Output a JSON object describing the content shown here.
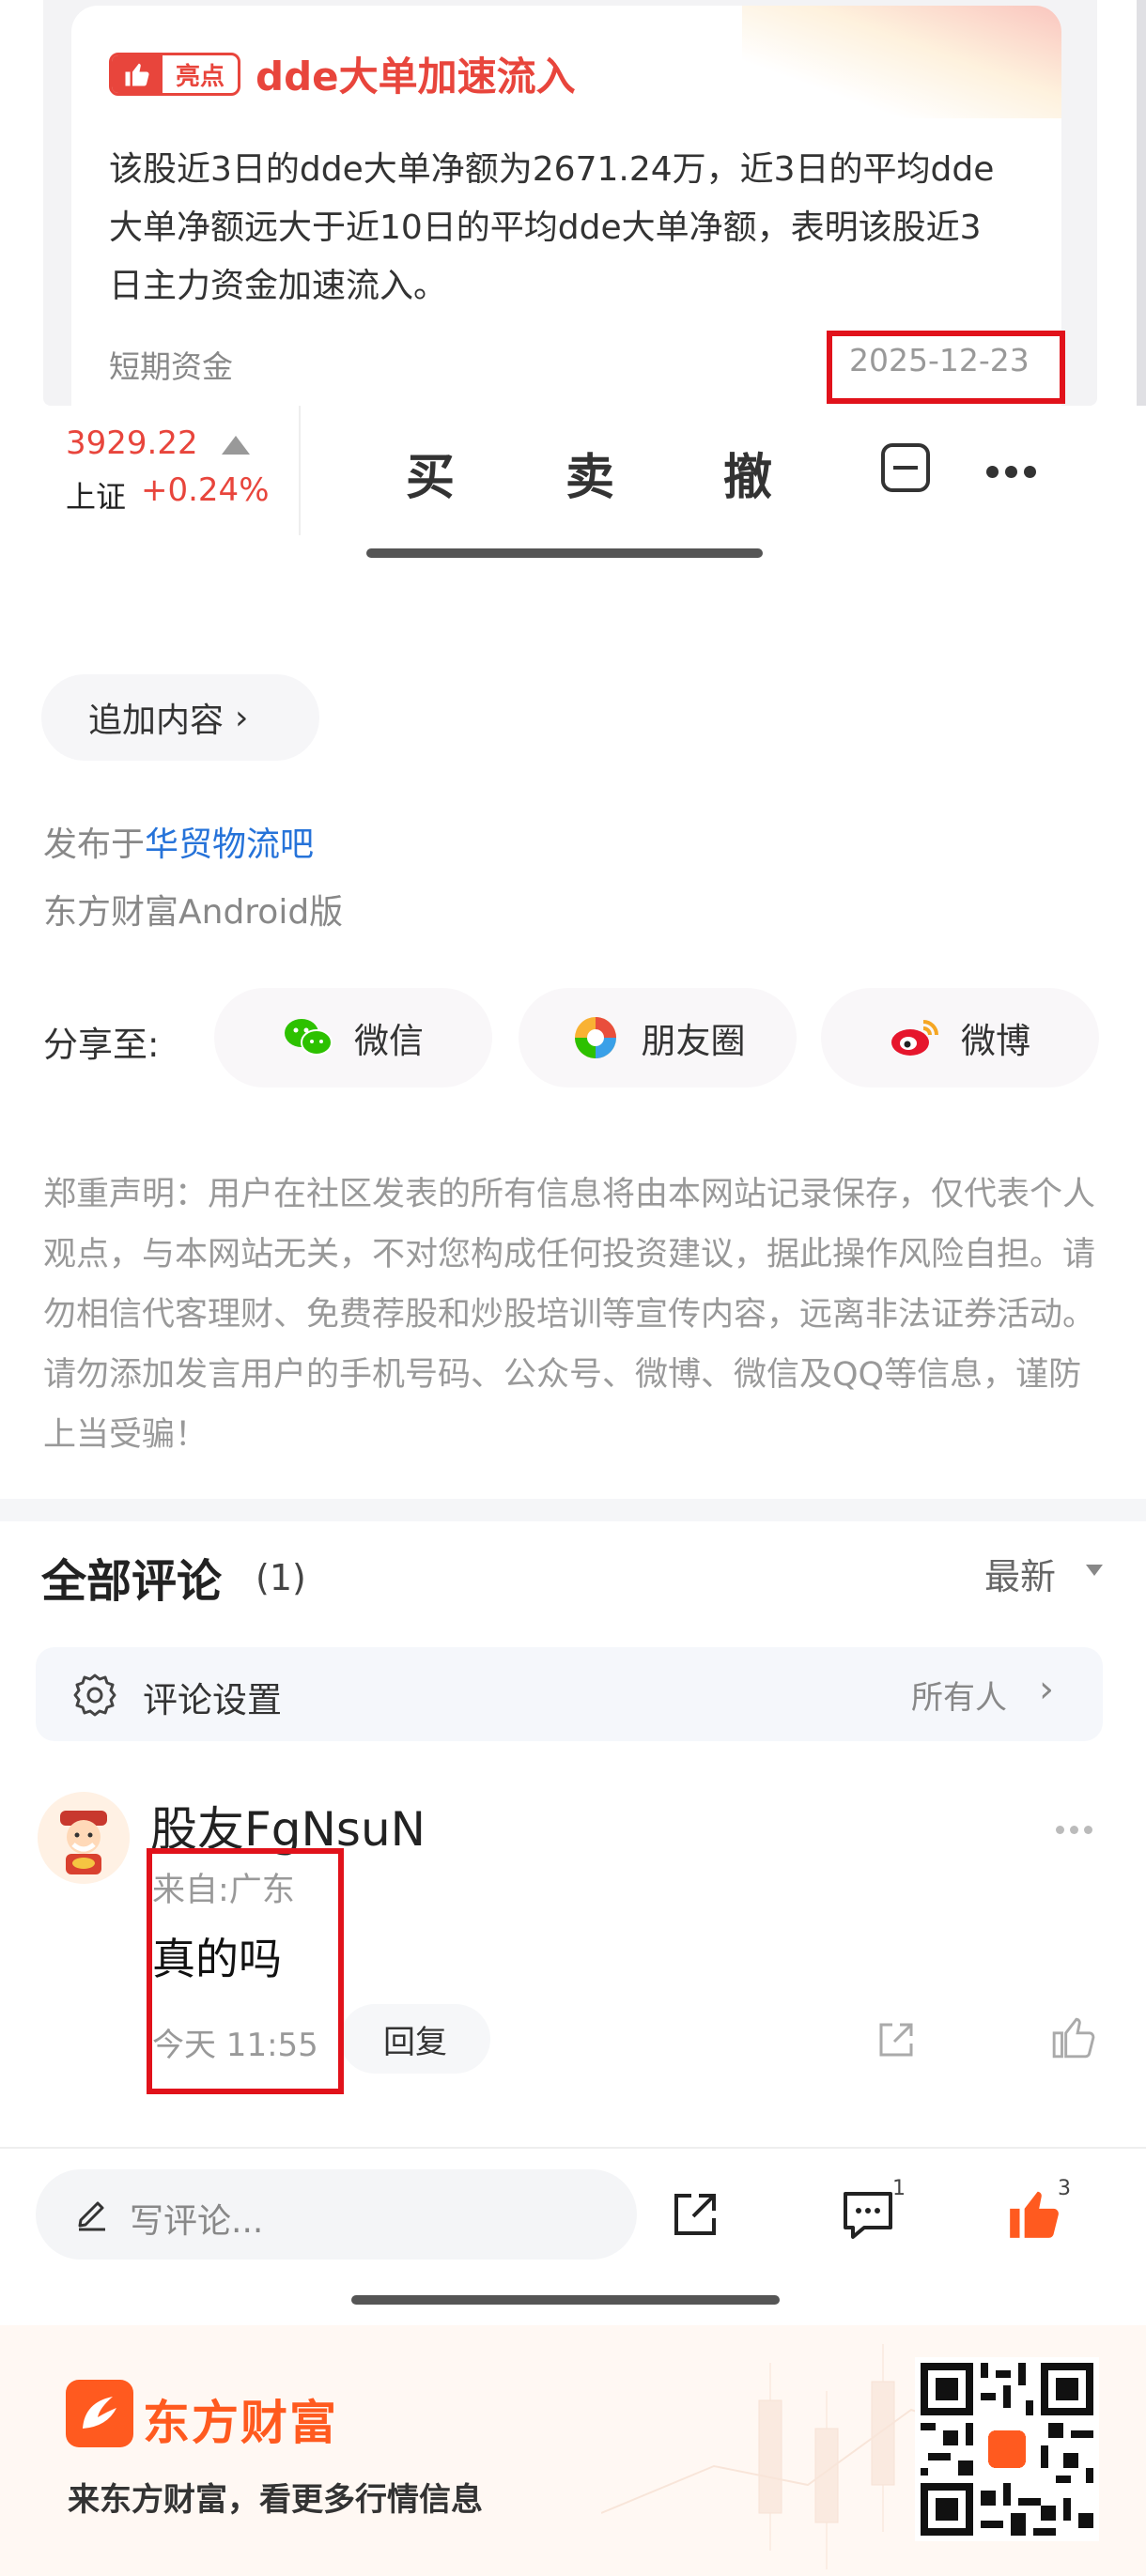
{
  "highlight_card": {
    "badge": "亮点",
    "title": "dde大单加速流入",
    "body": "该股近3日的dde大单净额为2671.24万，近3日的平均dde大单净额远大于近10日的平均dde大单净额，表明该股近3日主力资金加速流入。",
    "tag": "短期资金",
    "date": "2025-12-23"
  },
  "trade_bar": {
    "index_value": "3929.22",
    "index_name": "上证",
    "index_change": "+0.24%",
    "buy": "买",
    "sell": "卖",
    "cancel": "撤",
    "up_color": "#e8453c"
  },
  "post": {
    "append_label": "追加内容",
    "published_prefix": "发布于",
    "forum_name": "华贸物流吧",
    "client": "东方财富Android版"
  },
  "share": {
    "label": "分享至:",
    "wechat": "微信",
    "moments": "朋友圈",
    "weibo": "微博"
  },
  "disclaimer": "郑重声明：用户在社区发表的所有信息将由本网站记录保存，仅代表个人观点，与本网站无关，不对您构成任何投资建议，据此操作风险自担。请勿相信代客理财、免费荐股和炒股培训等宣传内容，远离非法证券活动。请勿添加发言用户的手机号码、公众号、微博、微信及QQ等信息，谨防上当受骗！",
  "comments": {
    "title": "全部评论",
    "count": "(1)",
    "sort": "最新",
    "settings_label": "评论设置",
    "settings_value": "所有人",
    "items": [
      {
        "user": "股友FgNsuN",
        "location": "来自:广东",
        "text": "真的吗",
        "time": "今天 11:55",
        "reply": "回复"
      }
    ]
  },
  "bottom_bar": {
    "input_placeholder": "写评论...",
    "comment_count": "1",
    "like_count": "3",
    "like_color": "#ff5a1f"
  },
  "footer": {
    "brand": "东方财富",
    "slogan": "来东方财富，看更多行情信息"
  }
}
